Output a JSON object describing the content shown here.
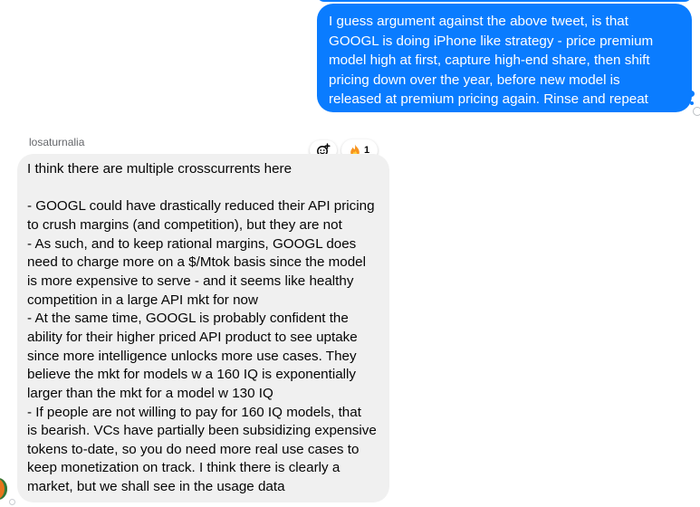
{
  "sent_message": {
    "lines": [
      "I guess argument against the above tweet, is that",
      "GOOGL is doing iPhone like strategy - price premium",
      "model high at first, capture high-end share, then shift",
      "pricing down over the year, before new model is",
      "released at premium pricing again. Rinse and repeat"
    ]
  },
  "received_message": {
    "sender": "losaturnalia",
    "reaction": {
      "icon": "fire-emoji-icon",
      "count": "1"
    },
    "lines": [
      "I think there are multiple crosscurrents here",
      "",
      "- GOOGL could have drastically reduced their API pricing",
      "to crush margins (and competition), but they are not",
      "- As such, and to keep rational margins, GOOGL does",
      "need to charge more on a $/Mtok basis since the model",
      "is more expensive to serve - and it seems like healthy",
      "competition in a large API mkt for now",
      "- At the same time, GOOGL is probably confident the",
      "ability for their higher priced API product to see uptake",
      "since more intelligence unlocks more use cases. They",
      "believe the mkt for models w a 160 IQ is exponentially",
      "larger than the mkt for a model w 130 IQ",
      "- If people are not willing to pay for 160 IQ models, that",
      "is bearish. VCs have partially been subsidizing expensive",
      "tokens to-date, so you do need more real use cases to",
      "keep monetization on track. I think there is clearly a",
      "market, but we shall see in the usage data"
    ]
  },
  "colors": {
    "sent_bubble": "#0a7cff",
    "received_bubble": "#f0f0f0",
    "text_dark": "#050505",
    "muted": "#65676b"
  }
}
